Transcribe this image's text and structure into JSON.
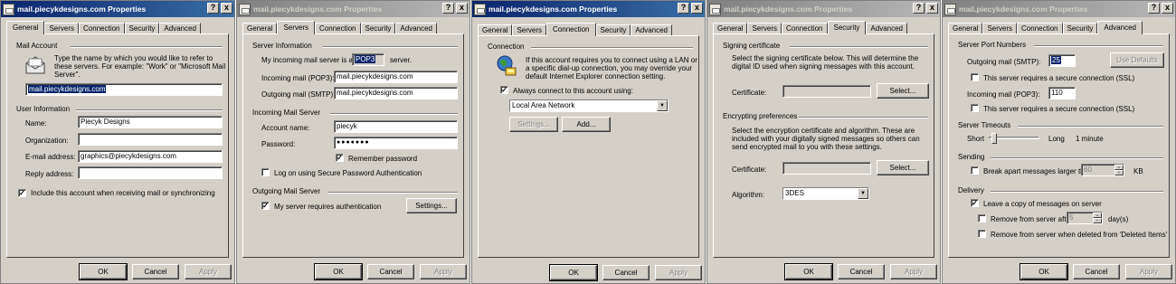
{
  "dialogs": [
    {
      "title": "mail.piecykdesigns.com Properties",
      "title_buttons": [
        "?",
        "x"
      ],
      "tabs": [
        "General",
        "Servers",
        "Connection",
        "Security",
        "Advanced"
      ],
      "active_tab": "General",
      "mail_account": {
        "group_title": "Mail Account",
        "description": "Type the name by which you would like to refer to these servers.  For example: \"Work\" or \"Microsoft Mail Server\".",
        "account_name": "mail.piecykdesigns.com"
      },
      "user_info": {
        "group_title": "User Information",
        "name_label": "Name:",
        "name_value": "Piecyk Designs",
        "organization_label": "Organization:",
        "organization_value": "",
        "email_label": "E-mail address:",
        "email_value": "graphics@piecykdesigns.com",
        "reply_label": "Reply address:",
        "reply_value": ""
      },
      "include_sync_label": "Include this account when receiving mail or synchronizing",
      "include_sync_checked": true,
      "buttons": {
        "ok": "OK",
        "cancel": "Cancel",
        "apply": "Apply"
      }
    },
    {
      "title": "mail.piecykdesigns.com Properties",
      "tabs": [
        "General",
        "Servers",
        "Connection",
        "Security",
        "Advanced"
      ],
      "active_tab": "Servers",
      "server_info": {
        "group_title": "Server Information",
        "incoming_is_prefix": "My incoming mail server is a",
        "incoming_type": "POP3",
        "incoming_is_suffix": "server.",
        "pop3_label": "Incoming mail (POP3):",
        "pop3_value": "mail.piecykdesigns.com",
        "smtp_label": "Outgoing mail (SMTP):",
        "smtp_value": "mail.piecykdesigns.com"
      },
      "incoming_server": {
        "group_title": "Incoming Mail Server",
        "account_label": "Account name:",
        "account_value": "piecyk",
        "password_label": "Password:",
        "password_value": "●●●●●●●",
        "remember_label": "Remember password",
        "remember_checked": true,
        "spa_label": "Log on using Secure Password Authentication",
        "spa_checked": false
      },
      "outgoing_server": {
        "group_title": "Outgoing Mail Server",
        "auth_label": "My server requires authentication",
        "auth_checked": true,
        "settings_button": "Settings..."
      },
      "buttons": {
        "ok": "OK",
        "cancel": "Cancel",
        "apply": "Apply"
      }
    },
    {
      "title": "mail.piecykdesigns.com Properties",
      "tabs": [
        "General",
        "Servers",
        "Connection",
        "Security",
        "Advanced"
      ],
      "active_tab": "Connection",
      "connection": {
        "group_title": "Connection",
        "description": "If this account requires you to connect using a LAN or a specific dial-up connection, you may override your default Internet Explorer connection setting.",
        "always_label": "Always connect to this account using:",
        "always_checked": true,
        "selected_connection": "Local Area Network",
        "settings_button": "Settings...",
        "add_button": "Add..."
      },
      "buttons": {
        "ok": "OK",
        "cancel": "Cancel",
        "apply": "Apply"
      }
    },
    {
      "title": "mail.piecykdesigns.com Properties",
      "tabs": [
        "General",
        "Servers",
        "Connection",
        "Security",
        "Advanced"
      ],
      "active_tab": "Security",
      "signing": {
        "group_title": "Signing certificate",
        "description": "Select the signing certificate below. This will determine the digital ID used when signing messages with this account.",
        "certificate_label": "Certificate:",
        "certificate_value": "",
        "select_button": "Select..."
      },
      "encrypting": {
        "group_title": "Encrypting preferences",
        "description": "Select the encryption certificate and algorithm. These are included with your digitally signed messages so others can send encrypted mail to you with these settings.",
        "certificate_label": "Certificate:",
        "certificate_value": "",
        "select_button": "Select...",
        "algorithm_label": "Algorithm:",
        "algorithm_value": "3DES"
      },
      "buttons": {
        "ok": "OK",
        "cancel": "Cancel",
        "apply": "Apply"
      }
    },
    {
      "title": "mail.piecykdesigns.com Properties",
      "tabs": [
        "General",
        "Servers",
        "Connection",
        "Security",
        "Advanced"
      ],
      "active_tab": "Advanced",
      "ports": {
        "group_title": "Server Port Numbers",
        "smtp_label": "Outgoing mail (SMTP):",
        "smtp_value": "25",
        "use_defaults_button": "Use Defaults",
        "smtp_ssl_label": "This server requires a secure connection (SSL)",
        "smtp_ssl_checked": false,
        "pop3_label": "Incoming mail (POP3):",
        "pop3_value": "110",
        "pop3_ssl_label": "This server requires a secure connection (SSL)",
        "pop3_ssl_checked": false
      },
      "timeouts": {
        "group_title": "Server Timeouts",
        "short_label": "Short",
        "long_label": "Long",
        "value_text": "1 minute",
        "slider_fraction": 0.05
      },
      "sending": {
        "group_title": "Sending",
        "break_label": "Break apart messages larger than",
        "break_checked": false,
        "break_value": "60",
        "unit": "KB"
      },
      "delivery": {
        "group_title": "Delivery",
        "leave_copy_label": "Leave a copy of messages on server",
        "leave_copy_checked": true,
        "remove_after_label": "Remove from server after",
        "remove_after_checked": false,
        "remove_after_value": "5",
        "days_label": "day(s)",
        "remove_deleted_label": "Remove from server when deleted from 'Deleted Items'",
        "remove_deleted_checked": false
      },
      "buttons": {
        "ok": "OK",
        "cancel": "Cancel",
        "apply": "Apply"
      }
    }
  ]
}
